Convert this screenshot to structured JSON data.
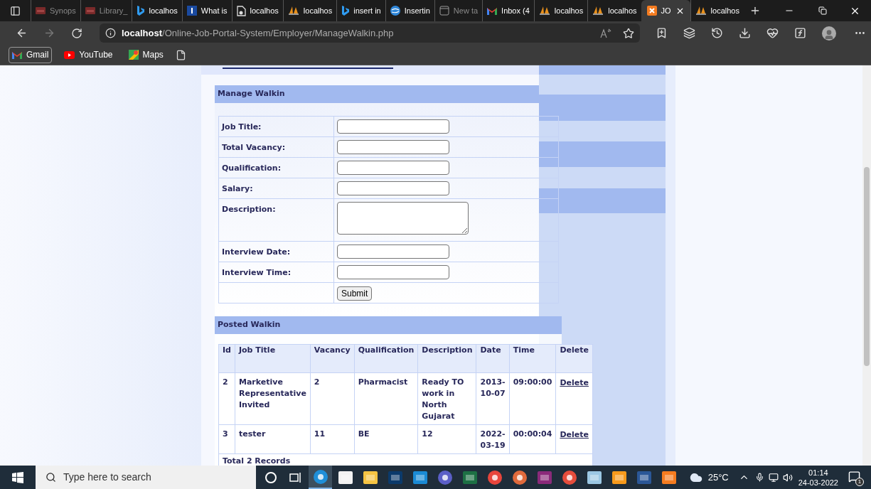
{
  "browser": {
    "tabs": [
      {
        "label": "Synops",
        "kind": "pdf",
        "selected": false,
        "sleeping": true
      },
      {
        "label": "Library_",
        "kind": "pdf",
        "selected": false,
        "sleeping": true
      },
      {
        "label": "localhos",
        "kind": "bing",
        "selected": false,
        "sleeping": false
      },
      {
        "label": "What is",
        "kind": "letter",
        "selected": false,
        "sleeping": false
      },
      {
        "label": "localhos",
        "kind": "file",
        "selected": false,
        "sleeping": false
      },
      {
        "label": "localhos",
        "kind": "stack",
        "selected": false,
        "sleeping": false
      },
      {
        "label": "insert in",
        "kind": "bing",
        "selected": false,
        "sleeping": false
      },
      {
        "label": "Insertin",
        "kind": "globe",
        "selected": false,
        "sleeping": false
      },
      {
        "label": "New ta",
        "kind": "newtab",
        "selected": false,
        "sleeping": true
      },
      {
        "label": "Inbox (4",
        "kind": "gmail",
        "selected": false,
        "sleeping": false
      },
      {
        "label": "localhos",
        "kind": "stack",
        "selected": false,
        "sleeping": false
      },
      {
        "label": "localhos",
        "kind": "stack",
        "selected": false,
        "sleeping": false
      },
      {
        "label": "JO",
        "kind": "xampp",
        "selected": true,
        "sleeping": false
      },
      {
        "label": "localhos",
        "kind": "stack",
        "selected": false,
        "sleeping": false
      }
    ],
    "address": {
      "host": "localhost",
      "path": "/Online-Job-Portal-System/Employer/ManageWalkin.php"
    },
    "bookmarks": [
      {
        "label": "Gmail",
        "kind": "gmail",
        "selected": true
      },
      {
        "label": "YouTube",
        "kind": "youtube",
        "selected": false
      },
      {
        "label": "Maps",
        "kind": "maps",
        "selected": false
      }
    ]
  },
  "manage_walkin": {
    "title": "Manage Walkin",
    "fields": [
      {
        "label": "Job Title:",
        "kind": "input"
      },
      {
        "label": "Total Vacancy:",
        "kind": "input"
      },
      {
        "label": "Qualification:",
        "kind": "input"
      },
      {
        "label": "Salary:",
        "kind": "input"
      },
      {
        "label": "Description:",
        "kind": "textarea"
      },
      {
        "label": "Interview Date:",
        "kind": "input"
      },
      {
        "label": "Interview Time:",
        "kind": "input"
      }
    ],
    "submit": "Submit"
  },
  "posted_walkin": {
    "title": "Posted Walkin",
    "columns": [
      "Id",
      "Job Title",
      "Vacancy",
      "Qualification",
      "Description",
      "Date",
      "Time",
      "Delete"
    ],
    "rows": [
      {
        "cells": [
          "2",
          "Marketive Representative Invited",
          "2",
          "Pharmacist",
          "Ready TO work in North Gujarat",
          "2013-10-07",
          "09:00:00"
        ],
        "link": "Delete"
      },
      {
        "cells": [
          "3",
          "tester",
          "11",
          "BE",
          "12",
          "2022-03-19",
          "00:00:04"
        ],
        "link": "Delete"
      }
    ],
    "footer": "Total 2 Records"
  },
  "taskbar": {
    "search": {
      "placeholder": "Type here to search"
    },
    "apps": [
      {
        "kind": "ring",
        "selected": false
      },
      {
        "kind": "taskview",
        "selected": false
      },
      {
        "kind": "round",
        "color": "#1f8fd8",
        "selected": true
      },
      {
        "kind": "tile",
        "color": "#f2f2f2",
        "selected": false
      },
      {
        "kind": "tile",
        "color": "#f6c443",
        "selected": false
      },
      {
        "kind": "tile",
        "color": "#0b3a6b",
        "selected": false
      },
      {
        "kind": "tile",
        "color": "#1a8ad4",
        "selected": false
      },
      {
        "kind": "round",
        "color": "#5b5fc7",
        "selected": false
      },
      {
        "kind": "tile",
        "color": "#1d7044",
        "selected": false
      },
      {
        "kind": "round",
        "color": "#e8453c",
        "selected": false
      },
      {
        "kind": "round",
        "color": "#e06a3c",
        "selected": false
      },
      {
        "kind": "tile",
        "color": "#8a2a7a",
        "selected": false
      },
      {
        "kind": "round",
        "color": "#e54d3c",
        "selected": false
      },
      {
        "kind": "tile",
        "color": "#9cc8e4",
        "selected": false
      },
      {
        "kind": "tile",
        "color": "#f79a1c",
        "selected": false
      },
      {
        "kind": "tile",
        "color": "#2b5797",
        "selected": false
      },
      {
        "kind": "tile",
        "color": "#f57c20",
        "selected": false
      }
    ],
    "temperature": "25°C",
    "time": "01:14",
    "date": "24-03-2022",
    "notifications": "1"
  }
}
